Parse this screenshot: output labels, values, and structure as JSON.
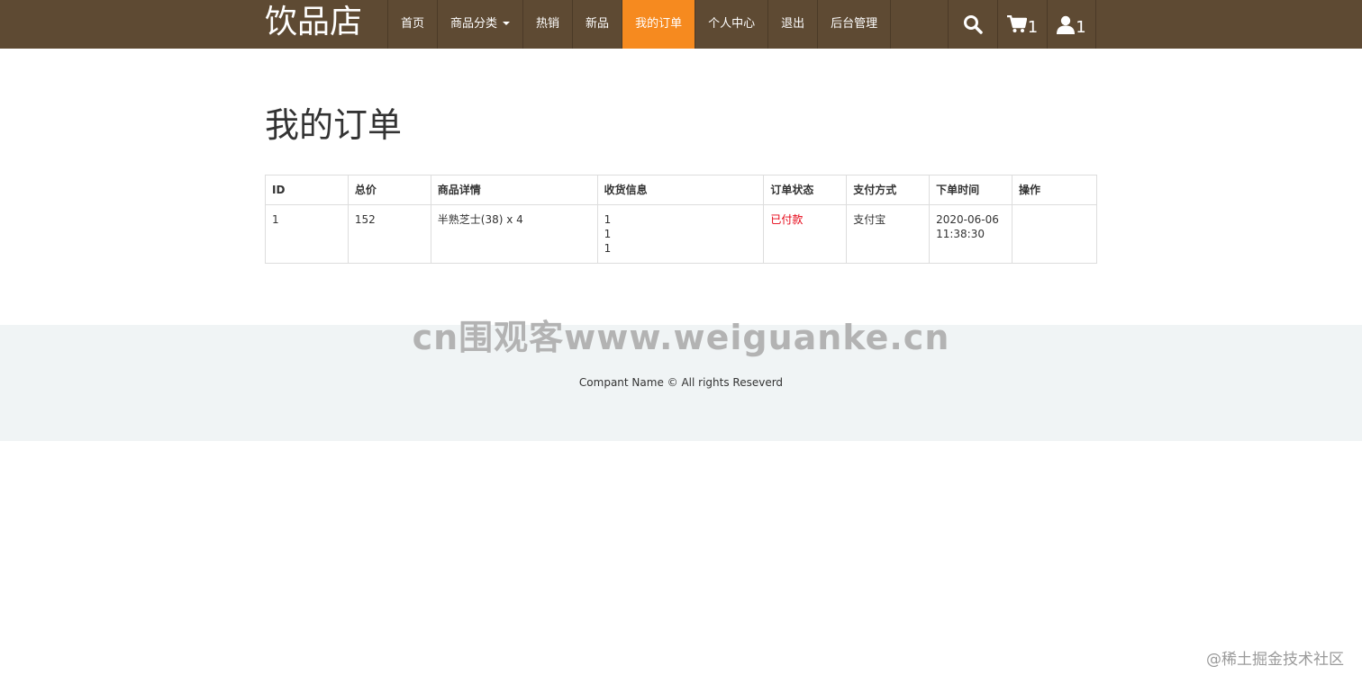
{
  "brand": "饮品店",
  "nav": {
    "items": [
      {
        "label": "首页"
      },
      {
        "label": "商品分类"
      },
      {
        "label": "热销"
      },
      {
        "label": "新品"
      },
      {
        "label": "我的订单"
      },
      {
        "label": "个人中心"
      },
      {
        "label": "退出"
      },
      {
        "label": "后台管理"
      }
    ],
    "active": "我的订单",
    "cart_count": "1",
    "user_count": "1",
    "icons": [
      "search-icon",
      "cart-icon",
      "user-icon"
    ]
  },
  "page_title": "我的订单",
  "orders_table": {
    "headers": [
      "ID",
      "总价",
      "商品详情",
      "收货信息",
      "订单状态",
      "支付方式",
      "下单时间",
      "操作"
    ],
    "rows": [
      {
        "id": "1",
        "total": "152",
        "detail": "半熟芝士(38) x 4",
        "shipping": [
          "1",
          "1",
          "1"
        ],
        "status": "已付款",
        "payment": "支付宝",
        "time_date": "2020-06-06",
        "time_clock": "11:38:30",
        "action": ""
      }
    ]
  },
  "watermark": "cn围观客www.weiguanke.cn",
  "footer": {
    "copyright": "Compant Name © All rights Reseverd"
  },
  "corner_watermark": "@稀土掘金技术社区",
  "colors": {
    "navbar": "#5e4a33",
    "active_nav": "#f68a1f",
    "status_paid": "#e60012",
    "footer_bg": "#f0f4f5"
  }
}
